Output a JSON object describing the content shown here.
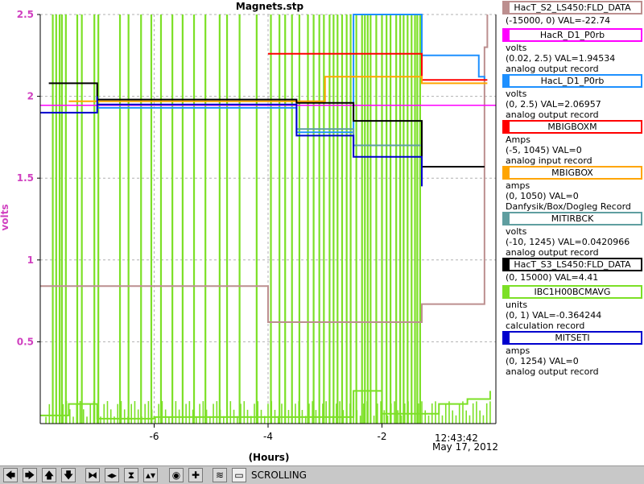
{
  "chart_data": {
    "type": "line",
    "title": "Magnets.stp",
    "xlabel": "(Hours)",
    "ylabel": "volts",
    "ylim": [
      0,
      2.5
    ],
    "xlim": [
      -8.0,
      0.0
    ],
    "x_ticks": [
      {
        "value": -6,
        "label": "-6"
      },
      {
        "value": -4,
        "label": "-4"
      },
      {
        "value": -2,
        "label": "-2"
      }
    ],
    "y_ticks": [
      {
        "value": 0.5,
        "label": "0.5"
      },
      {
        "value": 1,
        "label": "1"
      },
      {
        "value": 1.5,
        "label": "1.5"
      },
      {
        "value": 2,
        "label": "2"
      },
      {
        "value": 2.5,
        "label": "2.5"
      }
    ],
    "end_time": "12:43:42",
    "end_date": "May 17, 2012",
    "grid": true,
    "legend_position": "right",
    "series": [
      {
        "name": "HacT_S2_LS450:FLD_DATA",
        "color": "#bc8f8f",
        "x": [
          -8.0,
          -4.0,
          -4.0,
          -1.3,
          -1.3,
          -0.2,
          -0.2,
          -0.15
        ],
        "y": [
          0.84,
          0.84,
          0.62,
          0.62,
          0.73,
          0.73,
          2.3,
          2.5
        ]
      },
      {
        "name": "HacR_D1_P0rb",
        "color": "#ff00ff",
        "x": [
          -8.0,
          0.0
        ],
        "y": [
          1.945,
          1.945
        ]
      },
      {
        "name": "HacL_D1_P0rb",
        "color": "#1e90ff",
        "x": [
          -7.0,
          -6.0,
          -5.0,
          -3.5,
          -3.5,
          -2.5,
          -2.5,
          -1.3,
          -0.3,
          -0.2
        ],
        "y": [
          1.93,
          1.93,
          1.93,
          1.93,
          1.78,
          1.68,
          2.5,
          2.25,
          2.12,
          2.1
        ]
      },
      {
        "name": "MBIGBOXM",
        "color": "#ff0000",
        "x": [
          -4.0,
          -1.3,
          -1.3,
          -0.15
        ],
        "y": [
          2.26,
          2.26,
          2.1,
          2.1
        ]
      },
      {
        "name": "MBIGBOX",
        "color": "#ffa500",
        "x": [
          -7.5,
          -3.5,
          -3.0,
          -1.3,
          -1.3,
          -0.15
        ],
        "y": [
          1.97,
          1.97,
          2.12,
          2.12,
          2.08,
          2.08
        ]
      },
      {
        "name": "MITIRBCK",
        "color": "#5f9ea0",
        "x": [
          -3.5,
          -2.5,
          -1.3
        ],
        "y": [
          1.8,
          1.7,
          1.55
        ]
      },
      {
        "name": "HacT_S3_LS450:FLD_DATA",
        "color": "#000000",
        "x": [
          -7.85,
          -7.0,
          -7.0,
          -3.5,
          -2.5,
          -1.3,
          -1.3,
          -0.2
        ],
        "y": [
          2.08,
          2.08,
          1.98,
          1.96,
          1.85,
          1.7,
          1.57,
          1.57
        ]
      },
      {
        "name": "IBC1H00BCMAVG",
        "color": "#7ce026",
        "x": [
          -8.0,
          -7.5,
          -7.0,
          -6.0,
          -5.0,
          -4.0,
          -3.0,
          -2.5,
          -2.0,
          -1.0,
          -0.5,
          -0.1
        ],
        "y": [
          0.05,
          0.12,
          0.03,
          0.04,
          0.04,
          0.04,
          0.04,
          0.2,
          0.06,
          0.12,
          0.15,
          0.2
        ]
      },
      {
        "name": "MITSETI",
        "color": "#0000cd",
        "x": [
          -8.0,
          -7.0,
          -7.0,
          -3.5,
          -3.5,
          -2.5,
          -1.3
        ],
        "y": [
          1.9,
          2.0,
          1.95,
          1.95,
          1.76,
          1.63,
          1.45
        ]
      }
    ]
  },
  "legend": [
    {
      "title": "HacT_S2_LS450:FLD_DATA",
      "color": "#bc8f8f",
      "units": "",
      "range": "(-15000, 0) VAL=-22.74",
      "desc": ""
    },
    {
      "title": "HacR_D1_P0rb",
      "color": "#ff00ff",
      "units": "volts",
      "range": "(0.02, 2.5) VAL=1.94534",
      "desc": "analog output record"
    },
    {
      "title": "HacL_D1_P0rb",
      "color": "#1e90ff",
      "units": "volts",
      "range": "(0, 2.5) VAL=2.06957",
      "desc": "analog output record"
    },
    {
      "title": "MBIGBOXM",
      "color": "#ff0000",
      "units": "Amps",
      "range": "(-5, 1045) VAL=0",
      "desc": "analog input record"
    },
    {
      "title": "MBIGBOX",
      "color": "#ffa500",
      "units": "amps",
      "range": "(0, 1050) VAL=0",
      "desc": "Danfysik/Box/Dogleg Record"
    },
    {
      "title": "MITIRBCK",
      "color": "#5f9ea0",
      "units": "volts",
      "range": "(-10, 1245) VAL=0.0420966",
      "desc": "analog output record"
    },
    {
      "title": "HacT_S3_LS450:FLD_DATA",
      "color": "#000000",
      "units": "",
      "range": "(0, 15000) VAL=4.41",
      "desc": ""
    },
    {
      "title": "IBC1H00BCMAVG",
      "color": "#7ce026",
      "units": "units",
      "range": "(0, 1) VAL=-0.364244",
      "desc": "calculation record"
    },
    {
      "title": "MITSETI",
      "color": "#0000cd",
      "units": "amps",
      "range": "(0, 1254) VAL=0",
      "desc": "analog output record"
    }
  ],
  "toolbar": {
    "buttons": [
      {
        "icon": "arrow-left-icon",
        "glyph": "🡄"
      },
      {
        "icon": "arrow-right-icon",
        "glyph": "🡆"
      },
      {
        "icon": "arrow-up-icon",
        "glyph": "🡅"
      },
      {
        "icon": "arrow-down-icon",
        "glyph": "🡇"
      },
      {
        "icon": "zoom-in-x-icon",
        "glyph": "⧓"
      },
      {
        "icon": "zoom-out-x-icon",
        "glyph": "◂▸"
      },
      {
        "icon": "zoom-in-y-icon",
        "glyph": "⧗"
      },
      {
        "icon": "zoom-out-y-icon",
        "glyph": "▴▾"
      },
      {
        "icon": "record-icon",
        "glyph": "◉"
      },
      {
        "icon": "crosshair-icon",
        "glyph": "✚"
      },
      {
        "icon": "autoscale-icon",
        "glyph": "≋"
      },
      {
        "icon": "scroll-icon",
        "glyph": "▭"
      }
    ],
    "status": "SCROLLING"
  }
}
